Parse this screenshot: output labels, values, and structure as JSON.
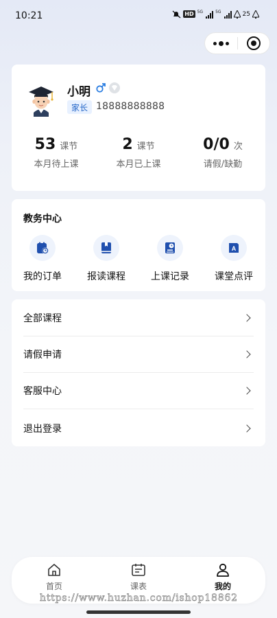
{
  "status_bar": {
    "time": "10:21",
    "hd": "HD",
    "net_label": "5G",
    "battery": "25"
  },
  "colors": {
    "accent": "#2466c8",
    "icon_blue": "#1f4fae",
    "male": "#2a7de1",
    "role_tag_bg": "#e8f1ff"
  },
  "profile": {
    "avatar_icon": "graduate-avatar-icon",
    "name": "小明",
    "gender_icon": "male-icon",
    "level_icon": "badge-icon",
    "role": "家长",
    "phone": "18888888888",
    "stats": [
      {
        "value": "53",
        "unit": "课节",
        "label": "本月待上课"
      },
      {
        "value": "2",
        "unit": "课节",
        "label": "本月已上课"
      },
      {
        "value": "0/0",
        "unit": "次",
        "label": "请假/缺勤"
      }
    ]
  },
  "services": {
    "title": "教务中心",
    "items": [
      {
        "label": "我的订单",
        "icon": "order-icon"
      },
      {
        "label": "报读课程",
        "icon": "enroll-book-icon"
      },
      {
        "label": "上课记录",
        "icon": "class-record-icon"
      },
      {
        "label": "课堂点评",
        "icon": "review-icon"
      }
    ]
  },
  "menu": {
    "items": [
      {
        "label": "全部课程"
      },
      {
        "label": "请假申请"
      },
      {
        "label": "客服中心"
      },
      {
        "label": "退出登录"
      }
    ]
  },
  "tabs": [
    {
      "label": "首页",
      "icon": "home-icon"
    },
    {
      "label": "课表",
      "icon": "calendar-icon"
    },
    {
      "label": "我的",
      "icon": "person-icon",
      "active": true
    }
  ],
  "watermark": "https://www.huzhan.com/ishop18862"
}
